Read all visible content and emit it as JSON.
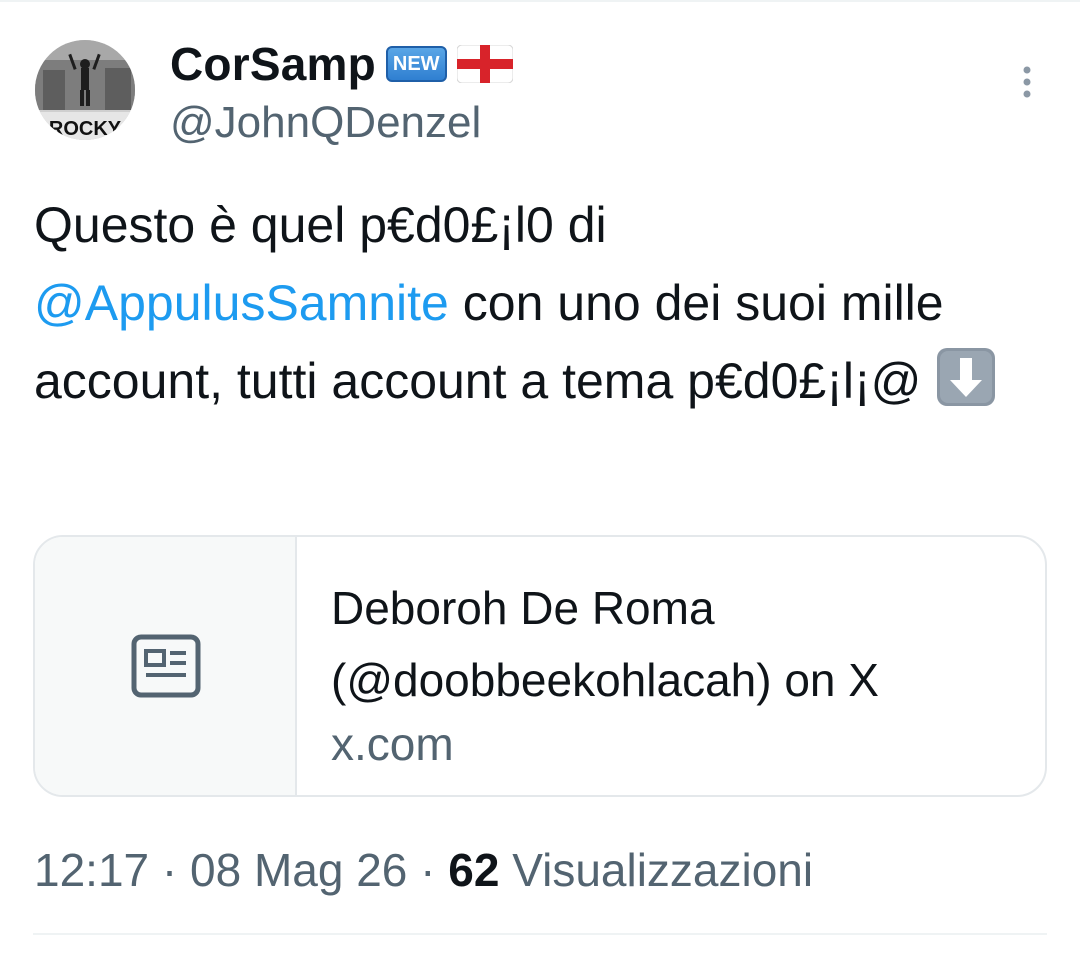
{
  "author": {
    "display_name": "CorSamp",
    "badge_text": "NEW",
    "handle": "@JohnQDenzel",
    "avatar_text": "ROCKY"
  },
  "tweet": {
    "text_part1": "Questo è quel p€d0£¡l0 di",
    "mention": "@AppulusSamnite",
    "text_part2": " con uno dei suoi mille account, tutti account a tema p€d0£¡l¡@ "
  },
  "link_card": {
    "title": "Deboroh De Roma (@doobbeekohlacah) on X",
    "domain": "x.com"
  },
  "meta": {
    "time": "12:17",
    "separator1": " · ",
    "date": "08 Mag 26",
    "separator2": " · ",
    "views_count": "62",
    "views_label": " Visualizzazioni"
  },
  "colors": {
    "accent": "#1d9bf0",
    "secondary_text": "#536471",
    "primary_text": "#0f1419"
  },
  "icons": {
    "more": "more-vertical-icon",
    "article": "article-icon",
    "flag": "england-flag-icon",
    "down_arrow": "down-arrow-emoji-icon"
  }
}
